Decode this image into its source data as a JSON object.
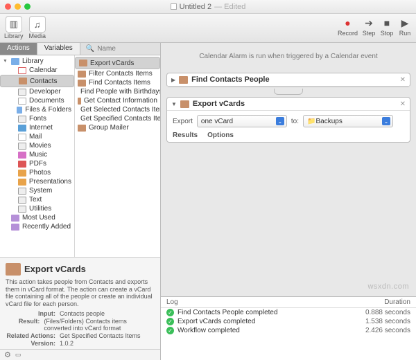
{
  "window": {
    "title": "Untitled 2",
    "edited": "— Edited"
  },
  "toolbar": {
    "library": "Library",
    "media": "Media",
    "record": "Record",
    "step": "Step",
    "stop": "Stop",
    "run": "Run"
  },
  "tabs": {
    "actions": "Actions",
    "variables": "Variables",
    "search_placeholder": "Name"
  },
  "library": {
    "root": "Library",
    "items": [
      "Calendar",
      "Contacts",
      "Developer",
      "Documents",
      "Files & Folders",
      "Fonts",
      "Internet",
      "Mail",
      "Movies",
      "Music",
      "PDFs",
      "Photos",
      "Presentations",
      "System",
      "Text",
      "Utilities"
    ],
    "extra": [
      "Most Used",
      "Recently Added"
    ]
  },
  "actions": [
    "Export vCards",
    "Filter Contacts Items",
    "Find Contacts Items",
    "Find People with Birthdays",
    "Get Contact Information",
    "Get Selected Contacts Items",
    "Get Specified Contacts Items",
    "Group Mailer"
  ],
  "detail": {
    "title": "Export vCards",
    "desc": "This action takes people from Contacts and exports them in vCard format. The action can create a vCard file containing all of the people or create an individual vCard file for each person.",
    "input_k": "Input:",
    "input_v": "Contacts people",
    "result_k": "Result:",
    "result_v": "(Files/Folders) Contacts items converted into vCard format",
    "related_k": "Related Actions:",
    "related_v": "Get Specified Contacts Items",
    "version_k": "Version:",
    "version_v": "1.0.2"
  },
  "banner": "Calendar Alarm is run when triggered by a Calendar event",
  "card_find": {
    "title": "Find Contacts People"
  },
  "card_export": {
    "title": "Export vCards",
    "export_label": "Export",
    "export_sel": "one vCard",
    "to_label": "to:",
    "to_sel": "Backups",
    "results": "Results",
    "options": "Options"
  },
  "log": {
    "col1": "Log",
    "col2": "Duration",
    "rows": [
      {
        "msg": "Find Contacts People completed",
        "dur": "0.888 seconds"
      },
      {
        "msg": "Export vCards completed",
        "dur": "1.538 seconds"
      },
      {
        "msg": "Workflow completed",
        "dur": "2.426 seconds"
      }
    ]
  },
  "watermark": "wsxdn.com"
}
